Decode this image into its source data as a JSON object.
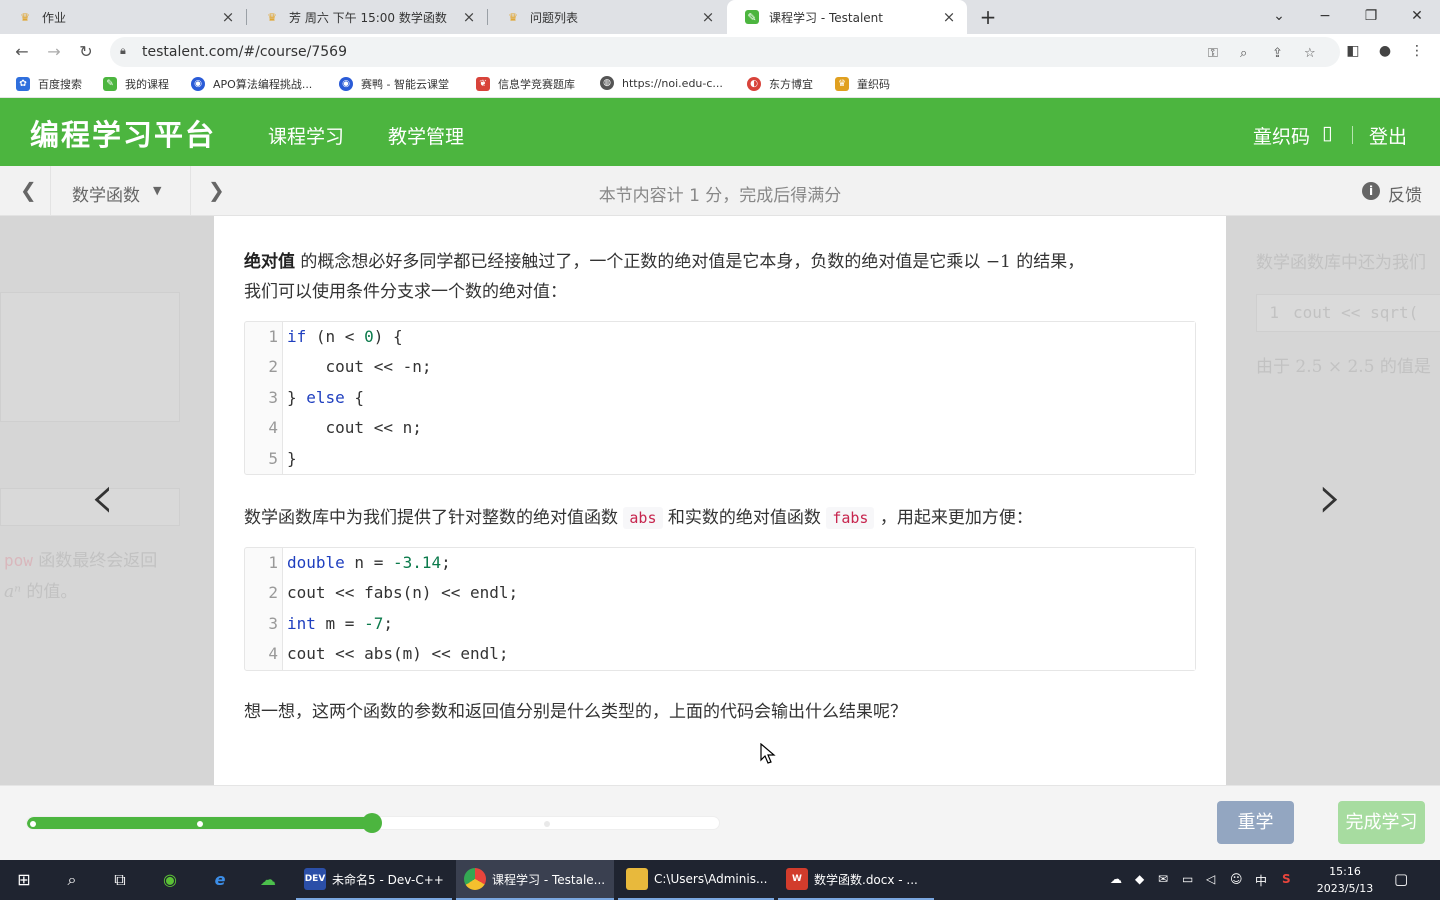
{
  "browser": {
    "tabs": [
      {
        "label": "作业"
      },
      {
        "label": "芳 周六 下午 15:00 数学函数"
      },
      {
        "label": "问题列表"
      },
      {
        "label": "课程学习 - Testalent"
      }
    ],
    "new_tab": "+",
    "url": "testalent.com/#/course/7569",
    "bookmarks": [
      {
        "label": "百度搜索",
        "color": "#2f6fdd"
      },
      {
        "label": "我的课程",
        "color": "#4cb53f"
      },
      {
        "label": "APO算法编程挑战...",
        "color": "#2a5bd7"
      },
      {
        "label": "赛鸭 - 智能云课堂",
        "color": "#2a5bd7"
      },
      {
        "label": "信息学竞赛题库",
        "color": "#d8433a"
      },
      {
        "label": "https://noi.edu-c...",
        "color": "#555555"
      },
      {
        "label": "东方博宜",
        "color": "#d8433a"
      },
      {
        "label": "童织码",
        "color": "#e0a020"
      }
    ]
  },
  "site": {
    "logo": "编程学习平台",
    "nav": [
      "课程学习",
      "教学管理"
    ],
    "user": "童织码",
    "user_icon": "▯",
    "logout": "登出",
    "accent": "#4cb53f"
  },
  "lesson": {
    "select": "数学函数",
    "info": "本节内容计 1 分，完成后得满分",
    "feedback": "反馈"
  },
  "content": {
    "p1_bold": "绝对值",
    "p1_text": " 的概念想必好多同学都已经接触过了，一个正数的绝对值是它本身，负数的绝对值是它乘以 ",
    "p1_math": "−1",
    "p1_tail": " 的结果，",
    "p1_line2": "我们可以使用条件分支求一个数的绝对值：",
    "code1_lines": [
      {
        "n": "1",
        "parts": [
          [
            "kw",
            "if"
          ],
          [
            "",
            " (n < "
          ],
          [
            "num",
            "0"
          ],
          [
            "",
            ") {"
          ]
        ]
      },
      {
        "n": "2",
        "parts": [
          [
            "",
            "    cout << -n;"
          ]
        ]
      },
      {
        "n": "3",
        "parts": [
          [
            "",
            "} "
          ],
          [
            "kw",
            "else"
          ],
          [
            "",
            " {"
          ]
        ]
      },
      {
        "n": "4",
        "parts": [
          [
            "",
            "    cout << n;"
          ]
        ]
      },
      {
        "n": "5",
        "parts": [
          [
            "",
            "}"
          ]
        ]
      }
    ],
    "p2_a": "数学函数库中为我们提供了针对整数的绝对值函数 ",
    "p2_code1": "abs",
    "p2_b": " 和实数的绝对值函数 ",
    "p2_code2": "fabs",
    "p2_c": " ，用起来更加方便：",
    "code2_lines": [
      {
        "n": "1",
        "parts": [
          [
            "kw",
            "double"
          ],
          [
            "",
            " n = "
          ],
          [
            "num",
            "-3.14"
          ],
          [
            "",
            ";"
          ]
        ]
      },
      {
        "n": "2",
        "parts": [
          [
            "",
            "cout << fabs(n) << endl;"
          ]
        ]
      },
      {
        "n": "3",
        "parts": [
          [
            "kw",
            "int"
          ],
          [
            "",
            " m = "
          ],
          [
            "num",
            "-7"
          ],
          [
            "",
            ";"
          ]
        ]
      },
      {
        "n": "4",
        "parts": [
          [
            "",
            "cout << abs(m) << endl;"
          ]
        ]
      }
    ],
    "p3": "想一想，这两个函数的参数和返回值分别是什么类型的，上面的代码会输出什么结果呢？"
  },
  "ghost_prev": {
    "code": "pow",
    "text": " 函数最终会返回",
    "math": "aⁿ",
    "text2": " 的值。"
  },
  "ghost_next": {
    "text1": "数学函数库中还为我们",
    "code_ln": "1",
    "code": "cout << sqrt(",
    "text2_a": "由于 ",
    "text2_math": "2.5 × 2.5",
    "text2_b": " 的值是"
  },
  "progress": {
    "fraction": 0.5,
    "relearn": "重学",
    "finish": "完成学习"
  },
  "taskbar": {
    "apps": [
      {
        "label": "未命名5 - Dev-C++",
        "icon_text": "DEV",
        "icon_color": "#2b4fa8"
      },
      {
        "label": "课程学习 - Testale...",
        "icon_text": "",
        "icon_color": "#e8453c"
      },
      {
        "label": "C:\\Users\\Adminis...",
        "icon_text": "",
        "icon_color": "#e8b93c"
      },
      {
        "label": "数学函数.docx - ...",
        "icon_text": "W",
        "icon_color": "#d23c2c"
      }
    ],
    "ime": "中",
    "time": "15:16",
    "date": "2023/5/13"
  }
}
